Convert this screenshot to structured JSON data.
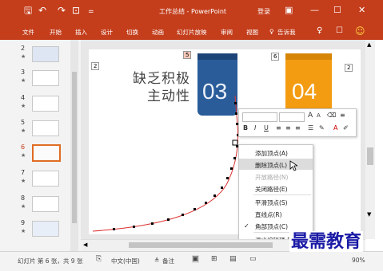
{
  "window": {
    "title": "工作总结 - PowerPoint",
    "login": "登录",
    "quick_access": {
      "save": "🖫",
      "undo": "↶",
      "redo": "↷",
      "present": "⊡",
      "more": "="
    },
    "controls": {
      "ribbon_display": "▣",
      "minimize": "—",
      "maximize": "☐",
      "close": "✕"
    }
  },
  "ribbon": {
    "tabs": [
      "文件",
      "开始",
      "插入",
      "设计",
      "切换",
      "动画",
      "幻灯片放映",
      "审阅",
      "视图"
    ],
    "tell_me": "告诉我",
    "icons": {
      "share": "♀",
      "comment": "☐",
      "smiley": "☺"
    }
  },
  "thumbnails": [
    {
      "number": "2",
      "star": "★"
    },
    {
      "number": "3",
      "star": "★"
    },
    {
      "number": "4",
      "star": "★"
    },
    {
      "number": "5",
      "star": "★"
    },
    {
      "number": "6",
      "star": "★",
      "selected": true
    },
    {
      "number": "7",
      "star": "★"
    },
    {
      "number": "8",
      "star": "★"
    },
    {
      "number": "9",
      "star": "★"
    }
  ],
  "slide": {
    "heading_line1": "缺乏积极",
    "heading_line2": "主动性",
    "badge_left": "2",
    "badge_5": "5",
    "badge_6": "6",
    "badge_right": "2",
    "card_blue_number": "03",
    "card_orange_number": "04",
    "color_blue": "#2a5c9a",
    "color_orange": "#f39c12"
  },
  "mini_toolbar": {
    "bold": "B",
    "italic": "I",
    "underline": "U",
    "grow": "A",
    "shrink": "A",
    "font_color": "A"
  },
  "context_menu": {
    "items": [
      {
        "label": "添加顶点(A)",
        "disabled": false,
        "highlight": false
      },
      {
        "label": "删除顶点(L)",
        "disabled": false,
        "highlight": true
      },
      {
        "label": "开放路径(N)",
        "disabled": true,
        "highlight": false
      },
      {
        "label": "关闭路径(E)",
        "disabled": false,
        "highlight": false
      },
      {
        "label": "平滑顶点(S)",
        "disabled": false,
        "highlight": false
      },
      {
        "label": "直线点(R)",
        "disabled": false,
        "highlight": false
      },
      {
        "label": "角部顶点(C)",
        "disabled": false,
        "highlight": false,
        "checked": true
      },
      {
        "label": "退出编辑顶点",
        "disabled": false,
        "highlight": false
      }
    ],
    "checkmark": "✓"
  },
  "status": {
    "slide_info": "幻灯片 第 6 张，共 9 张",
    "language": "中文(中国)",
    "notes": "备注",
    "zoom": "90%"
  },
  "watermark": "最需教育"
}
